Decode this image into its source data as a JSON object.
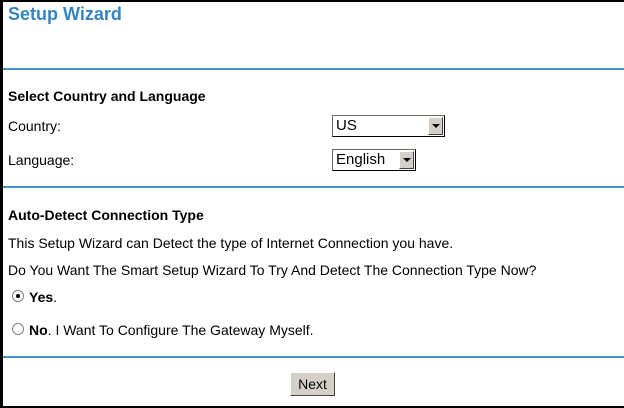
{
  "title": "Setup Wizard",
  "country_language": {
    "heading": "Select Country and Language",
    "country_label": "Country:",
    "country_value": "US",
    "language_label": "Language:",
    "language_value": "English"
  },
  "auto_detect": {
    "heading": "Auto-Detect Connection Type",
    "line1": "This Setup Wizard can Detect the type of Internet Connection you have.",
    "line2": "Do You Want The Smart Setup Wizard To Try And Detect The Connection Type Now?",
    "yes_bold": "Yes",
    "yes_rest": ".",
    "yes_checked": true,
    "no_bold": "No",
    "no_rest": ". I Want To Configure The Gateway Myself.",
    "no_checked": false
  },
  "next_label": "Next",
  "colors": {
    "title": "#3585c0",
    "rule": "#3a96c9",
    "button_face": "#d4d0c8"
  }
}
